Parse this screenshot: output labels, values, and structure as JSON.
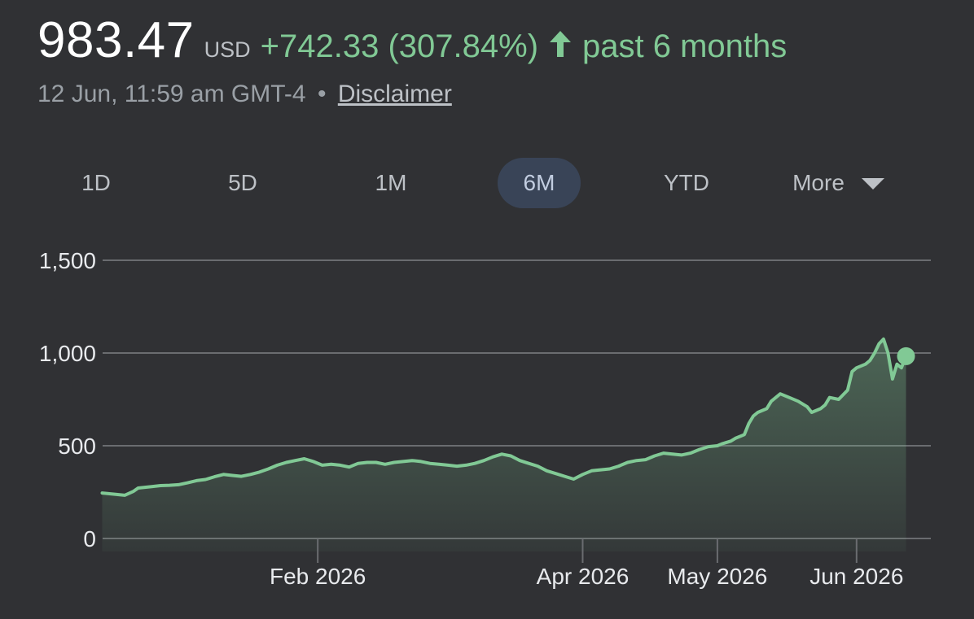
{
  "quote": {
    "price": "983.47",
    "currency": "USD",
    "change": "+742.33 (307.84%)",
    "direction_icon": "arrow-up-icon",
    "period": "past 6 months",
    "timestamp": "12 Jun, 11:59 am GMT-4",
    "separator": "•",
    "disclaimer": "Disclaimer",
    "accent_color": "#81c995"
  },
  "range_tabs": [
    {
      "label": "1D",
      "selected": false
    },
    {
      "label": "5D",
      "selected": false
    },
    {
      "label": "1M",
      "selected": false
    },
    {
      "label": "6M",
      "selected": true
    },
    {
      "label": "YTD",
      "selected": false
    },
    {
      "label": "More",
      "selected": false
    }
  ],
  "chart_data": {
    "type": "area",
    "title": "",
    "xlabel": "",
    "ylabel": "",
    "ylim": [
      0,
      1500
    ],
    "xlim": [
      "2025-12-14",
      "2026-06-15"
    ],
    "y_ticks": [
      0,
      500,
      1000,
      1500
    ],
    "y_tick_labels": [
      "0",
      "500",
      "1,000",
      "1,500"
    ],
    "x_ticks": [
      "2026-02-01",
      "2026-04-01",
      "2026-05-01",
      "2026-06-01"
    ],
    "x_tick_labels": [
      "Feb 2026",
      "Apr 2026",
      "May 2026",
      "Jun 2026"
    ],
    "grid": true,
    "line_color": "#81c995",
    "series": [
      {
        "x": [
          "2025-12-15",
          "2025-12-18",
          "2025-12-20",
          "2025-12-22",
          "2025-12-23",
          "2025-12-26",
          "2025-12-28",
          "2025-12-30",
          "2026-01-01",
          "2026-01-03",
          "2026-01-05",
          "2026-01-07",
          "2026-01-09",
          "2026-01-11",
          "2026-01-13",
          "2026-01-15",
          "2026-01-17",
          "2026-01-19",
          "2026-01-21",
          "2026-01-23",
          "2026-01-25",
          "2026-01-27",
          "2026-01-29",
          "2026-01-31",
          "2026-02-02",
          "2026-02-04",
          "2026-02-06",
          "2026-02-08",
          "2026-02-10",
          "2026-02-12",
          "2026-02-14",
          "2026-02-16",
          "2026-02-18",
          "2026-02-20",
          "2026-02-22",
          "2026-02-24",
          "2026-02-26",
          "2026-02-28",
          "2026-03-02",
          "2026-03-04",
          "2026-03-06",
          "2026-03-08",
          "2026-03-10",
          "2026-03-12",
          "2026-03-14",
          "2026-03-16",
          "2026-03-18",
          "2026-03-20",
          "2026-03-22",
          "2026-03-24",
          "2026-03-26",
          "2026-03-28",
          "2026-03-30",
          "2026-04-01",
          "2026-04-03",
          "2026-04-05",
          "2026-04-07",
          "2026-04-09",
          "2026-04-11",
          "2026-04-13",
          "2026-04-15",
          "2026-04-17",
          "2026-04-19",
          "2026-04-21",
          "2026-04-23",
          "2026-04-25",
          "2026-04-27",
          "2026-04-29",
          "2026-05-01",
          "2026-05-02",
          "2026-05-04",
          "2026-05-05",
          "2026-05-07",
          "2026-05-08",
          "2026-05-09",
          "2026-05-10",
          "2026-05-12",
          "2026-05-13",
          "2026-05-15",
          "2026-05-17",
          "2026-05-19",
          "2026-05-21",
          "2026-05-22",
          "2026-05-24",
          "2026-05-25",
          "2026-05-26",
          "2026-05-28",
          "2026-05-30",
          "2026-05-31",
          "2026-06-01",
          "2026-06-03",
          "2026-06-04",
          "2026-06-05",
          "2026-06-06",
          "2026-06-07",
          "2026-06-08",
          "2026-06-09",
          "2026-06-10",
          "2026-06-11",
          "2026-06-12"
        ],
        "values": [
          245,
          238,
          233,
          255,
          272,
          280,
          285,
          287,
          290,
          300,
          312,
          318,
          333,
          345,
          340,
          335,
          345,
          358,
          375,
          395,
          410,
          420,
          430,
          415,
          395,
          400,
          395,
          385,
          405,
          410,
          410,
          400,
          410,
          415,
          420,
          415,
          405,
          400,
          395,
          390,
          395,
          405,
          420,
          440,
          455,
          445,
          420,
          405,
          390,
          365,
          350,
          335,
          320,
          345,
          365,
          370,
          375,
          390,
          410,
          420,
          425,
          445,
          460,
          455,
          450,
          460,
          480,
          495,
          500,
          510,
          525,
          540,
          560,
          620,
          660,
          680,
          700,
          740,
          780,
          760,
          740,
          710,
          680,
          700,
          720,
          760,
          750,
          800,
          900,
          920,
          940,
          960,
          1000,
          1050,
          1075,
          1000,
          860,
          940,
          920,
          983
        ]
      }
    ]
  }
}
